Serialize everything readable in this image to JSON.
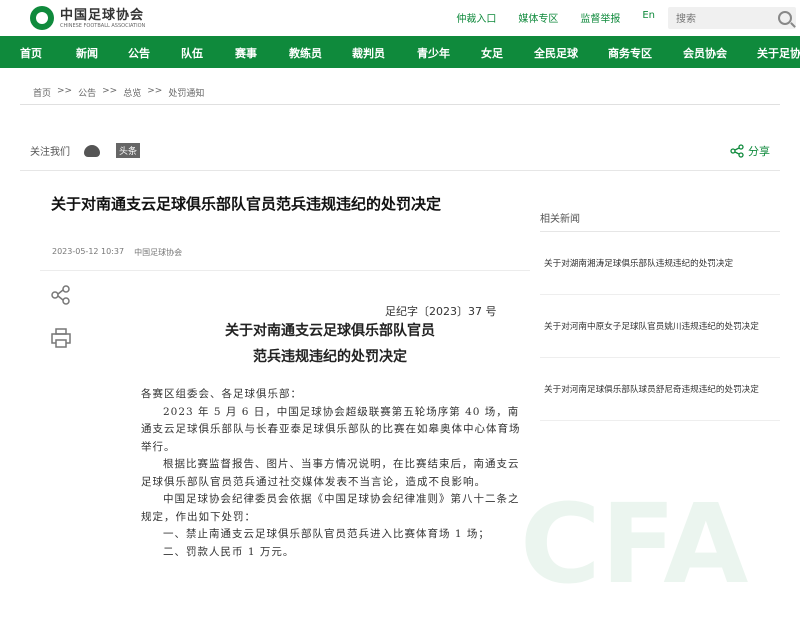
{
  "header": {
    "logo_cn": "中国足球协会",
    "logo_en": "CHINESE FOOTBALL ASSOCIATION",
    "links": [
      "仲裁入口",
      "媒体专区",
      "监督举报",
      "En"
    ],
    "search_placeholder": "搜索"
  },
  "nav": {
    "items": [
      "首页",
      "新闻",
      "公告",
      "队伍",
      "赛事",
      "教练员",
      "裁判员",
      "青少年",
      "女足",
      "全民足球",
      "商务专区",
      "会员协会",
      "关于足协"
    ]
  },
  "breadcrumb": [
    "首页",
    ">>",
    "公告",
    ">>",
    "总览",
    ">>",
    "处罚通知"
  ],
  "follow": {
    "label": "关注我们",
    "toutiao": "头条"
  },
  "share_label": "分享",
  "article": {
    "title": "关于对南通支云足球俱乐部队官员范兵违规违纪的处罚决定",
    "date": "2023-05-12 10:37",
    "source": "中国足球协会",
    "doc_no": "足纪字〔2023〕37 号",
    "doc_title_1": "关于对南通支云足球俱乐部队官员",
    "doc_title_2": "范兵违规违纪的处罚决定",
    "paragraphs": [
      "各赛区组委会、各足球俱乐部：",
      "2023 年 5 月 6 日，中国足球协会超级联赛第五轮场序第 40 场，南通支云足球俱乐部队与长春亚泰足球俱乐部队的比赛在如皋奥体中心体育场举行。",
      "根据比赛监督报告、图片、当事方情况说明，在比赛结束后，南通支云足球俱乐部队官员范兵通过社交媒体发表不当言论，造成不良影响。",
      "中国足球协会纪律委员会依据《中国足球协会纪律准则》第八十二条之规定，作出如下处罚：",
      "一、禁止南通支云足球俱乐部队官员范兵进入比赛体育场 1 场；",
      "二、罚款人民币 1 万元。"
    ]
  },
  "sidebar": {
    "title": "相关新闻",
    "items": [
      "关于对湖南湘涛足球俱乐部队违规违纪的处罚决定",
      "关于对河南中原女子足球队官员姚川违规违纪的处罚决定",
      "关于对河南足球俱乐部队球员舒尼奇违规违纪的处罚决定"
    ]
  },
  "colors": {
    "brand_green": "#0f8a3c"
  }
}
